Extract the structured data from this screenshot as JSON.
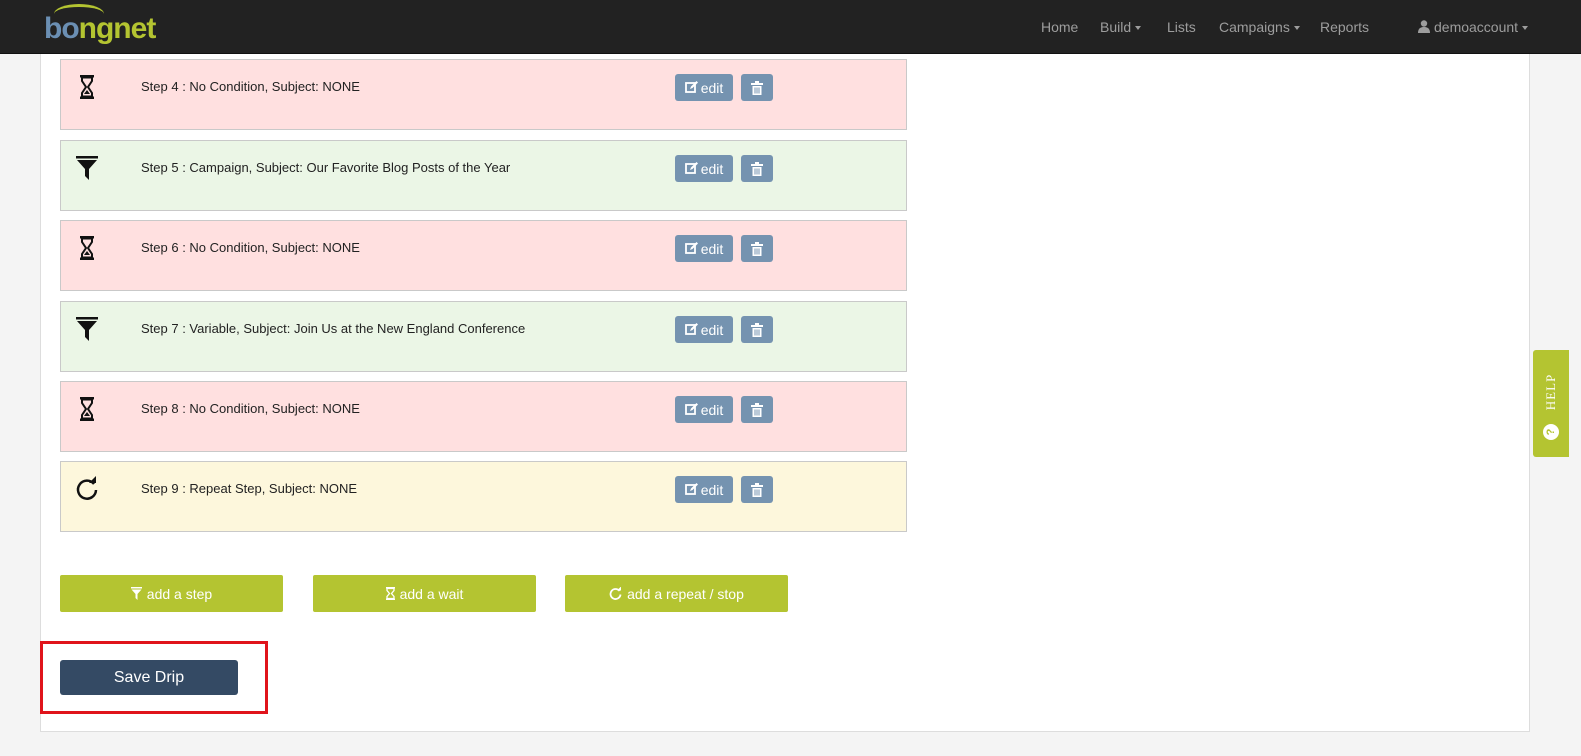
{
  "nav": {
    "logo_part1": "bo",
    "logo_part2": "ngnet",
    "home": "Home",
    "build": "Build",
    "lists": "Lists",
    "campaigns": "Campaigns",
    "reports": "Reports",
    "account": "demoaccount"
  },
  "steps": [
    {
      "type": "wait",
      "icon": "hourglass-icon",
      "text": "Step 4 : No Condition, Subject: NONE",
      "edit_label": "edit"
    },
    {
      "type": "filter",
      "icon": "filter-icon",
      "text": "Step 5 : Campaign, Subject: Our Favorite Blog Posts of the Year",
      "edit_label": "edit"
    },
    {
      "type": "wait",
      "icon": "hourglass-icon",
      "text": "Step 6 : No Condition, Subject: NONE",
      "edit_label": "edit"
    },
    {
      "type": "filter",
      "icon": "filter-icon",
      "text": "Step 7 : Variable, Subject: Join Us at the New England Conference",
      "edit_label": "edit"
    },
    {
      "type": "wait",
      "icon": "hourglass-icon",
      "text": "Step 8 : No Condition, Subject: NONE",
      "edit_label": "edit"
    },
    {
      "type": "repeat",
      "icon": "refresh-icon",
      "text": "Step 9 : Repeat Step, Subject: NONE",
      "edit_label": "edit"
    }
  ],
  "actions": {
    "add_step": "add a step",
    "add_wait": "add a wait",
    "add_repeat": "add a repeat / stop"
  },
  "save_label": "Save Drip",
  "help_label": "HELP",
  "help_icon_glyph": "?",
  "colors": {
    "brand_green": "#b4c431",
    "brand_blue": "#6b8fb3",
    "button_blue": "#7593b0",
    "save_button": "#344a64",
    "highlight_red": "#e0141b",
    "wait_bg": "#ffe0e0",
    "filter_bg": "#ebf6e6",
    "repeat_bg": "#fdf7dc"
  }
}
